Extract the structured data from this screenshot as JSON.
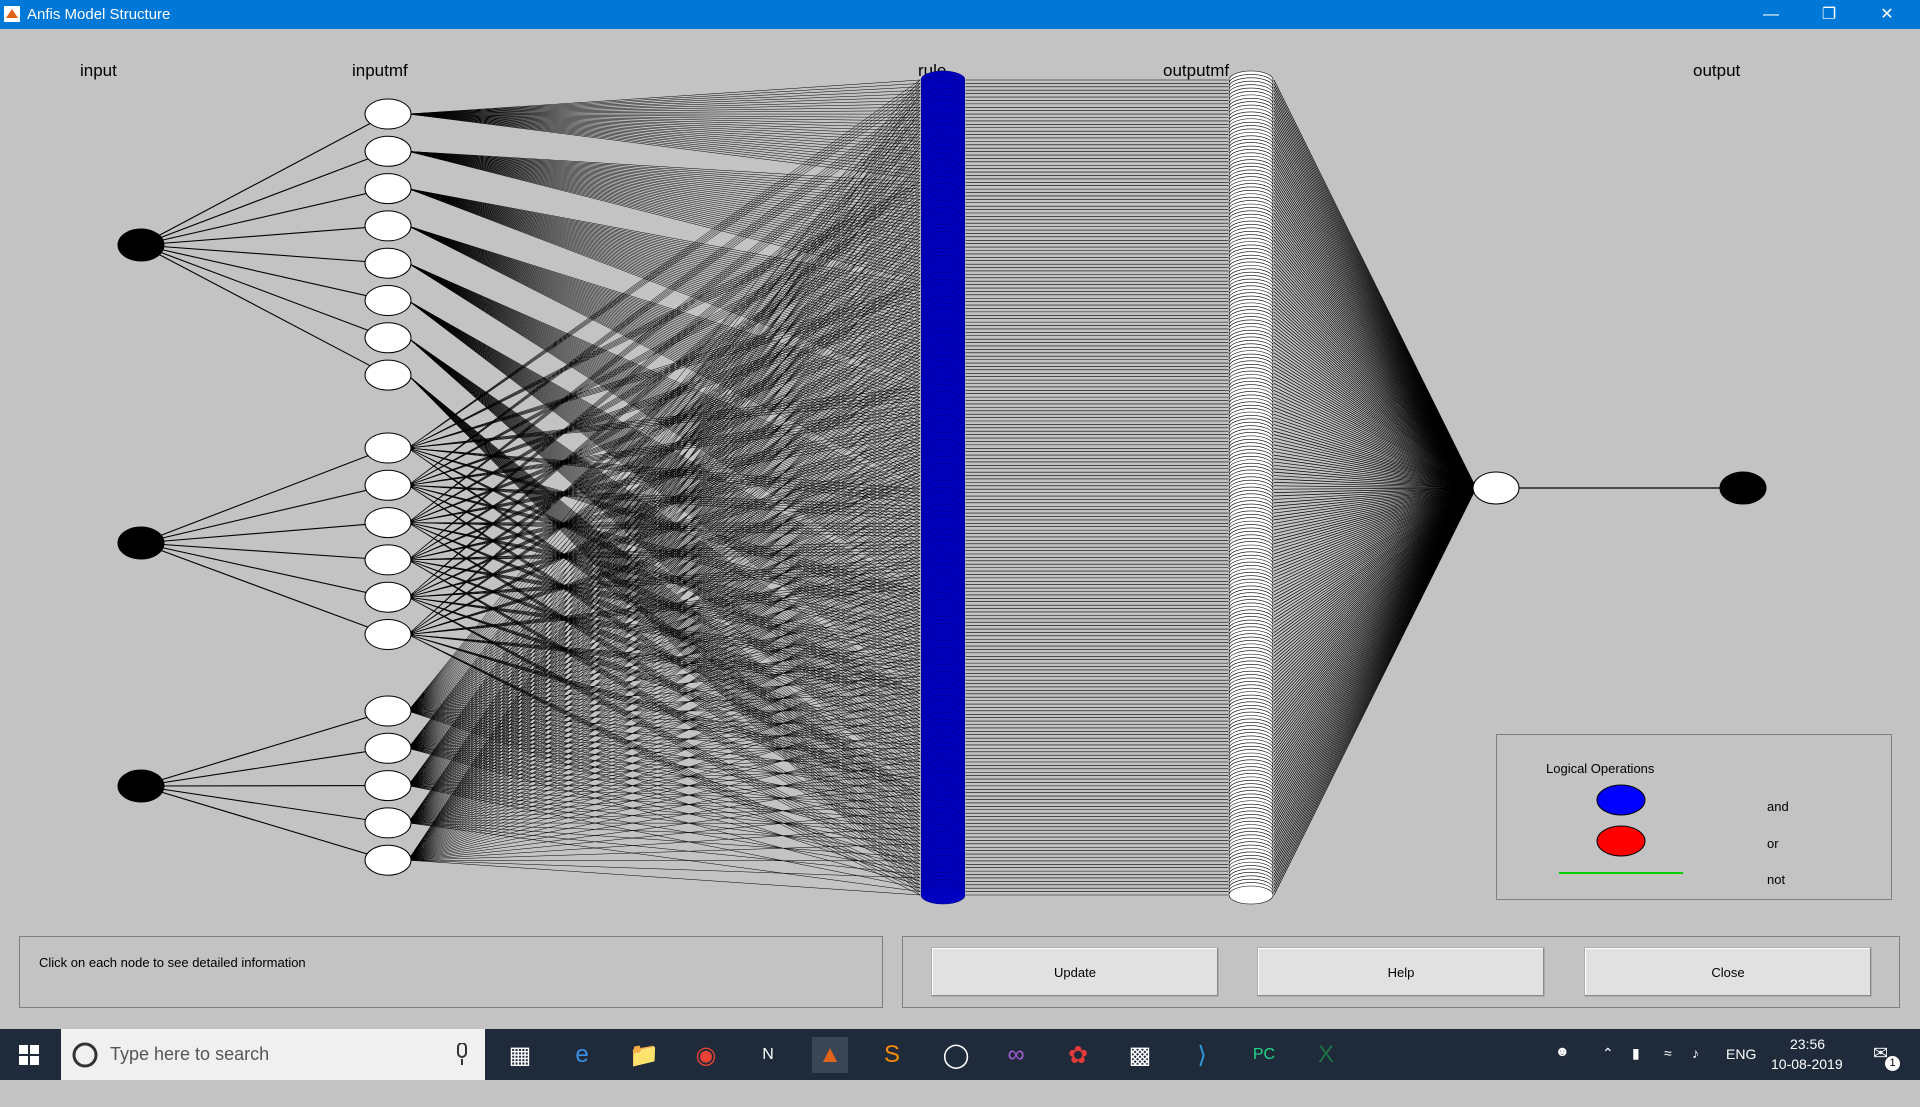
{
  "window": {
    "title": "Anfis Model Structure"
  },
  "columns": {
    "input": "input",
    "inputmf": "inputmf",
    "rule": "rule",
    "outputmf": "outputmf",
    "output": "output"
  },
  "info": {
    "message": "Click on each node to see detailed information"
  },
  "buttons": {
    "update": "Update",
    "help": "Help",
    "close": "Close"
  },
  "legend": {
    "title": "Logical Operations",
    "and_label": "and",
    "or_label": "or",
    "not_label": "not",
    "and_color": "#0000ff",
    "or_color": "#ff0000",
    "not_color": "#00cc00"
  },
  "network": {
    "inputs": 3,
    "membership_functions_per_input": [
      8,
      6,
      5
    ],
    "rule_count": 240,
    "outputs": 1,
    "rule_color": "#0000c0"
  },
  "taskbar": {
    "search_placeholder": "Type here to search",
    "apps": [
      "task-view-icon",
      "edge-icon",
      "file-explorer-icon",
      "chrome-icon",
      "notion-icon",
      "matlab-icon",
      "sublime-icon",
      "media-icon",
      "visual-studio-icon",
      "network-tool-icon",
      "terminal-icon",
      "vscode-icon",
      "pycharm-icon",
      "excel-icon"
    ],
    "language": "ENG",
    "time": "23:56",
    "date": "10-08-2019",
    "notifications": "1"
  }
}
